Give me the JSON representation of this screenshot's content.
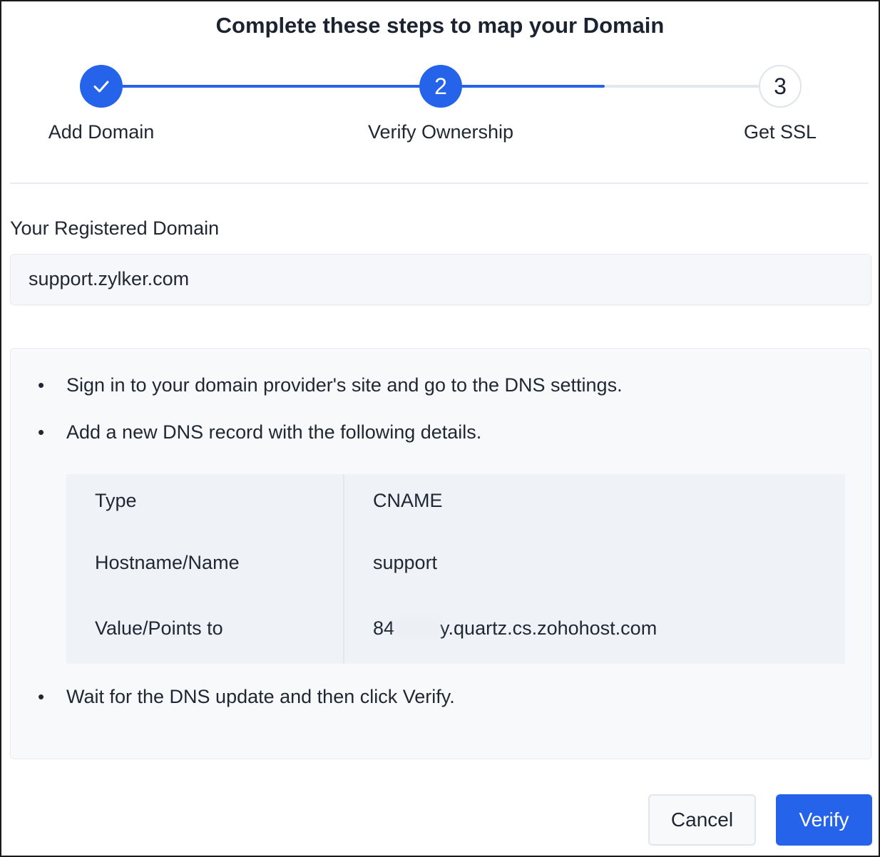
{
  "title": "Complete these steps to map your Domain",
  "steps": [
    {
      "label": "Add Domain",
      "status": "completed",
      "icon": "check-icon"
    },
    {
      "label": "Verify Ownership",
      "number": "2",
      "status": "current"
    },
    {
      "label": "Get SSL",
      "number": "3",
      "status": "pending"
    }
  ],
  "domain_field": {
    "label": "Your Registered Domain",
    "value": "support.zylker.com"
  },
  "instructions": {
    "bullet_char": "•",
    "step1": "Sign in to your domain provider's site and go to the DNS settings.",
    "step2": "Add a new DNS record with the following details.",
    "step3": "Wait for the DNS update and then click Verify."
  },
  "dns_record": {
    "rows": [
      {
        "key": "Type",
        "value": "CNAME"
      },
      {
        "key": "Hostname/Name",
        "value": "support"
      },
      {
        "key": "Value/Points to",
        "value_prefix": "84",
        "value_suffix": "y.quartz.cs.zohohost.com"
      }
    ]
  },
  "buttons": {
    "cancel": "Cancel",
    "verify": "Verify"
  },
  "colors": {
    "accent": "#2563eb",
    "track_inactive": "#e3e8ef",
    "panel_bg": "#f7f9fb"
  }
}
